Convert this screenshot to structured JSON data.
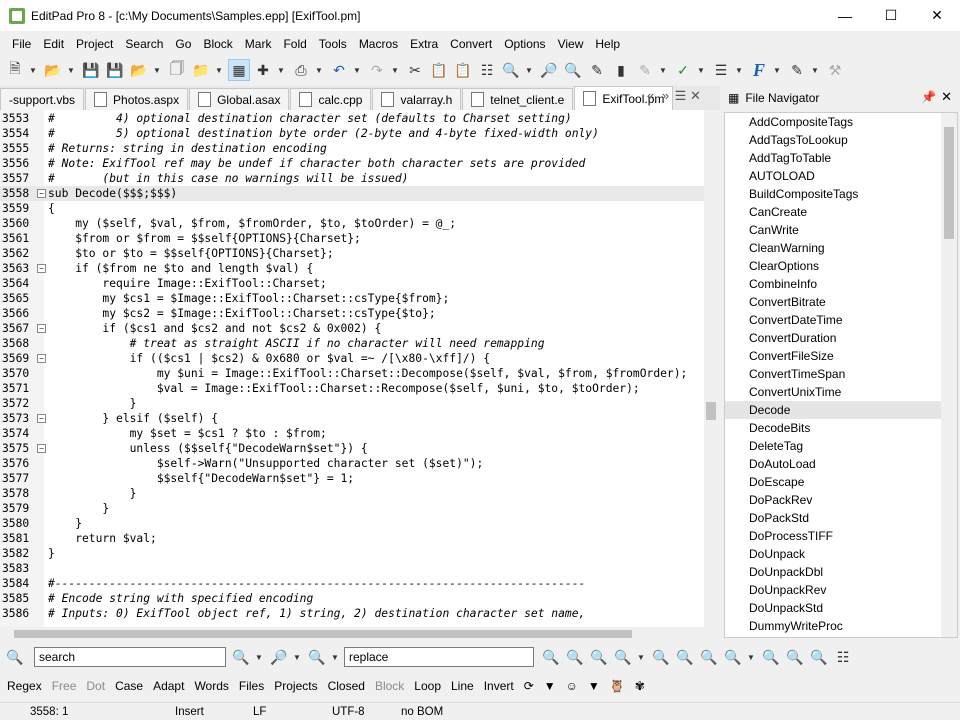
{
  "window": {
    "title": "EditPad Pro 8 - [c:\\My Documents\\Samples.epp] [ExifTool.pm]"
  },
  "menu": [
    "File",
    "Edit",
    "Project",
    "Search",
    "Go",
    "Block",
    "Mark",
    "Fold",
    "Tools",
    "Macros",
    "Extra",
    "Convert",
    "Options",
    "View",
    "Help"
  ],
  "tabs": [
    {
      "label": "-support.vbs"
    },
    {
      "label": "Photos.aspx"
    },
    {
      "label": "Global.asax"
    },
    {
      "label": "calc.cpp"
    },
    {
      "label": "valarray.h"
    },
    {
      "label": "telnet_client.e"
    },
    {
      "label": "ExifTool.pm",
      "active": true
    }
  ],
  "file_navigator": {
    "title": "File Navigator",
    "items": [
      "AddCompositeTags",
      "AddTagsToLookup",
      "AddTagToTable",
      "AUTOLOAD",
      "BuildCompositeTags",
      "CanCreate",
      "CanWrite",
      "CleanWarning",
      "ClearOptions",
      "CombineInfo",
      "ConvertBitrate",
      "ConvertDateTime",
      "ConvertDuration",
      "ConvertFileSize",
      "ConvertTimeSpan",
      "ConvertUnixTime",
      "Decode",
      "DecodeBits",
      "DeleteTag",
      "DoAutoLoad",
      "DoEscape",
      "DoPackRev",
      "DoPackStd",
      "DoProcessTIFF",
      "DoUnpack",
      "DoUnpackDbl",
      "DoUnpackRev",
      "DoUnpackStd",
      "DummyWriteProc"
    ],
    "selected": "Decode"
  },
  "editor": {
    "lines": [
      {
        "n": "3553",
        "t": "#         4) optional destination character set (defaults to Charset setting)",
        "c": "cm"
      },
      {
        "n": "3554",
        "t": "#         5) optional destination byte order (2-byte and 4-byte fixed-width only)",
        "c": "cm"
      },
      {
        "n": "3555",
        "t": "# Returns: string in destination encoding",
        "c": "cm"
      },
      {
        "n": "3556",
        "t": "# Note: ExifTool ref may be undef if character both character sets are provided",
        "c": "cm"
      },
      {
        "n": "3557",
        "t": "#       (but in this case no warnings will be issued)",
        "c": "cm"
      },
      {
        "n": "3558",
        "t": "sub Decode($$$;$$$)",
        "c": "",
        "cur": true,
        "fold": "-"
      },
      {
        "n": "3559",
        "t": "{",
        "c": ""
      },
      {
        "n": "3560",
        "t": "    my ($self, $val, $from, $fromOrder, $to, $toOrder) = @_;",
        "c": ""
      },
      {
        "n": "3561",
        "t": "    $from or $from = $$self{OPTIONS}{Charset};",
        "c": ""
      },
      {
        "n": "3562",
        "t": "    $to or $to = $$self{OPTIONS}{Charset};",
        "c": ""
      },
      {
        "n": "3563",
        "t": "    if ($from ne $to and length $val) {",
        "c": "",
        "fold": "-"
      },
      {
        "n": "3564",
        "t": "        require Image::ExifTool::Charset;",
        "c": ""
      },
      {
        "n": "3565",
        "t": "        my $cs1 = $Image::ExifTool::Charset::csType{$from};",
        "c": ""
      },
      {
        "n": "3566",
        "t": "        my $cs2 = $Image::ExifTool::Charset::csType{$to};",
        "c": ""
      },
      {
        "n": "3567",
        "t": "        if ($cs1 and $cs2 and not $cs2 & 0x002) {",
        "c": "",
        "fold": "-"
      },
      {
        "n": "3568",
        "t": "            # treat as straight ASCII if no character will need remapping",
        "c": "cm"
      },
      {
        "n": "3569",
        "t": "            if (($cs1 | $cs2) & 0x680 or $val =~ /[\\x80-\\xff]/) {",
        "c": "",
        "fold": "-"
      },
      {
        "n": "3570",
        "t": "                my $uni = Image::ExifTool::Charset::Decompose($self, $val, $from, $fromOrder);",
        "c": ""
      },
      {
        "n": "3571",
        "t": "                $val = Image::ExifTool::Charset::Recompose($self, $uni, $to, $toOrder);",
        "c": ""
      },
      {
        "n": "3572",
        "t": "            }",
        "c": ""
      },
      {
        "n": "3573",
        "t": "        } elsif ($self) {",
        "c": "",
        "fold": "-"
      },
      {
        "n": "3574",
        "t": "            my $set = $cs1 ? $to : $from;",
        "c": ""
      },
      {
        "n": "3575",
        "t": "            unless ($$self{\"DecodeWarn$set\"}) {",
        "c": "",
        "fold": "-"
      },
      {
        "n": "3576",
        "t": "                $self->Warn(\"Unsupported character set ($set)\");",
        "c": ""
      },
      {
        "n": "3577",
        "t": "                $$self{\"DecodeWarn$set\"} = 1;",
        "c": ""
      },
      {
        "n": "3578",
        "t": "            }",
        "c": ""
      },
      {
        "n": "3579",
        "t": "        }",
        "c": ""
      },
      {
        "n": "3580",
        "t": "    }",
        "c": ""
      },
      {
        "n": "3581",
        "t": "    return $val;",
        "c": ""
      },
      {
        "n": "3582",
        "t": "}",
        "c": ""
      },
      {
        "n": "3583",
        "t": "",
        "c": ""
      },
      {
        "n": "3584",
        "t": "#------------------------------------------------------------------------------",
        "c": "cm"
      },
      {
        "n": "3585",
        "t": "# Encode string with specified encoding",
        "c": "cm"
      },
      {
        "n": "3586",
        "t": "# Inputs: 0) ExifTool object ref, 1) string, 2) destination character set name,",
        "c": "cm"
      }
    ]
  },
  "search": {
    "search_value": "search",
    "replace_value": "replace"
  },
  "options": [
    {
      "label": "Regex",
      "disabled": false
    },
    {
      "label": "Free",
      "disabled": true
    },
    {
      "label": "Dot",
      "disabled": true
    },
    {
      "label": "Case",
      "disabled": false
    },
    {
      "label": "Adapt",
      "disabled": false
    },
    {
      "label": "Words",
      "disabled": false
    },
    {
      "label": "Files",
      "disabled": false
    },
    {
      "label": "Projects",
      "disabled": false
    },
    {
      "label": "Closed",
      "disabled": false
    },
    {
      "label": "Block",
      "disabled": true
    },
    {
      "label": "Loop",
      "disabled": false
    },
    {
      "label": "Line",
      "disabled": false
    },
    {
      "label": "Invert",
      "disabled": false
    }
  ],
  "status": {
    "position": "3558: 1",
    "mode": "Insert",
    "line_break": "LF",
    "encoding": "UTF-8",
    "bom": "no BOM"
  }
}
